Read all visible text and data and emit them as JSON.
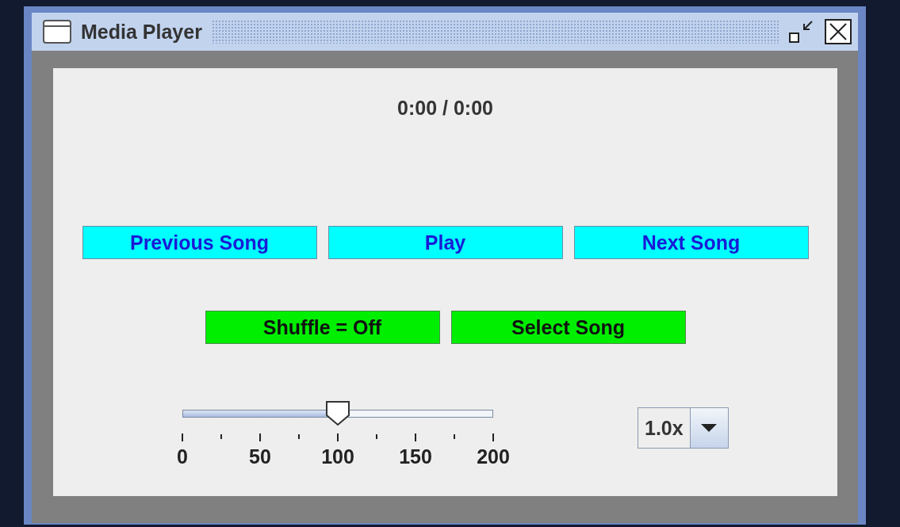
{
  "window": {
    "title": "Media Player"
  },
  "time": "0:00 / 0:00",
  "button_rows": [
    [
      {
        "label": "Previous Song",
        "kind": "navigation"
      },
      {
        "label": "Play",
        "kind": "navigation"
      },
      {
        "label": "Next Song",
        "kind": "navigation"
      }
    ],
    [
      {
        "label": "Shuffle = Off",
        "kind": "option"
      },
      {
        "label": "Select Song",
        "kind": "option"
      }
    ]
  ],
  "volume_slider": {
    "level": 0.5,
    "tick_labels": [
      "0",
      "50",
      "100",
      "150",
      "200"
    ]
  },
  "speed_combo": {
    "value": "1.0x"
  }
}
